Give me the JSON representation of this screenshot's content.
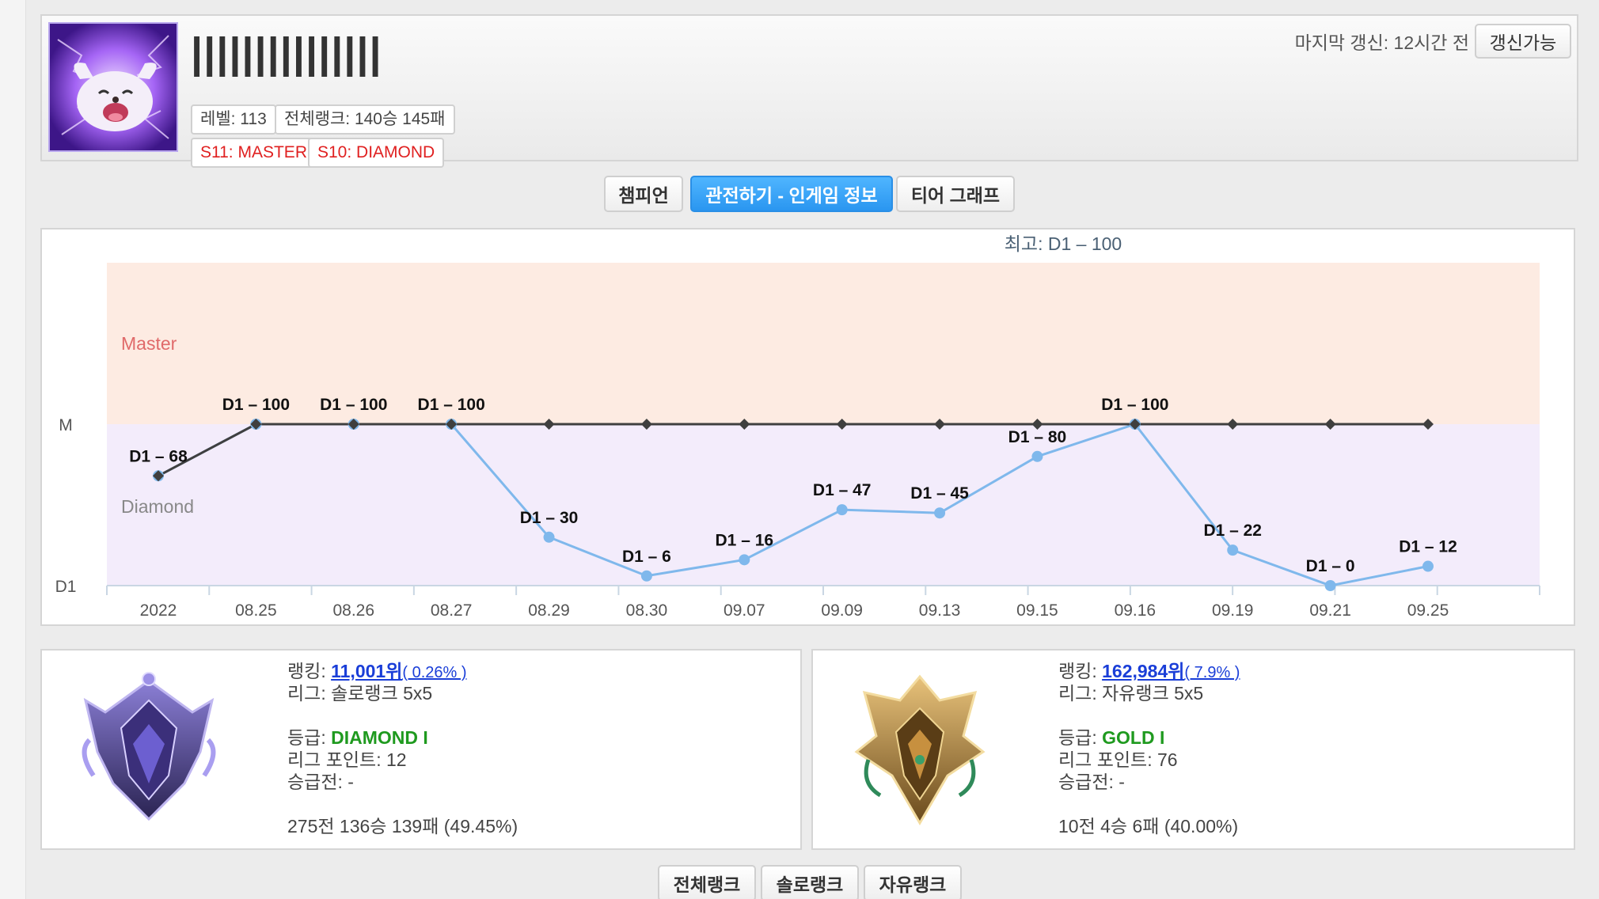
{
  "profile": {
    "name": "|||||||||||||||",
    "level": "레벨: 113",
    "overall_rank": "전체랭크: 140승 145패",
    "season_tags": [
      "S11: MASTER",
      "S10: DIAMOND"
    ],
    "last_update": "마지막 갱신: 12시간 전",
    "refresh_label": "갱신가능"
  },
  "tabs": [
    "챔피언",
    "관전하기 - 인게임 정보",
    "티어 그래프"
  ],
  "active_tab": 1,
  "colors": {
    "accent": "#2a96f0",
    "master_band": "#fdebe2",
    "diamond_band": "#f3ecfb",
    "line_current": "#7fb8ec",
    "line_max": "#3f3f3f",
    "tier_green": "#1f9a1f",
    "link_blue": "#1a3ed8",
    "tag_red": "#e02020"
  },
  "chart_data": {
    "type": "line",
    "title": "최고: D1 – 100",
    "y_tick_labels": [
      "M",
      "D1"
    ],
    "band_labels": [
      "Master",
      "Diamond"
    ],
    "categories": [
      "2022",
      "08.25",
      "08.26",
      "08.27",
      "08.29",
      "08.30",
      "09.07",
      "09.09",
      "09.13",
      "09.15",
      "09.16",
      "09.19",
      "09.21",
      "09.25"
    ],
    "ylim": [
      0,
      200
    ],
    "series": [
      {
        "role": "highest",
        "values": [
          68,
          100,
          100,
          100,
          100,
          100,
          100,
          100,
          100,
          100,
          100,
          100,
          100,
          100
        ]
      },
      {
        "role": "current",
        "values": [
          68,
          100,
          100,
          100,
          30,
          6,
          16,
          47,
          45,
          80,
          100,
          22,
          0,
          12
        ]
      }
    ],
    "data_labels": [
      {
        "index": 0,
        "text": "D1 – 68"
      },
      {
        "index": 1,
        "text": "D1 – 100"
      },
      {
        "index": 2,
        "text": "D1 – 100"
      },
      {
        "index": 3,
        "text": "D1 – 100"
      },
      {
        "index": 4,
        "text": "D1 – 30"
      },
      {
        "index": 5,
        "text": "D1 – 6"
      },
      {
        "index": 6,
        "text": "D1 – 16"
      },
      {
        "index": 7,
        "text": "D1 – 47"
      },
      {
        "index": 8,
        "text": "D1 – 45"
      },
      {
        "index": 9,
        "text": "D1 – 80"
      },
      {
        "index": 10,
        "text": "D1 – 100"
      },
      {
        "index": 11,
        "text": "D1 – 22"
      },
      {
        "index": 12,
        "text": "D1 – 0"
      },
      {
        "index": 13,
        "text": "D1 – 12"
      }
    ]
  },
  "solo": {
    "ranking_label": "랭킹: ",
    "ranking": "11,001위",
    "ranking_pct": "( 0.26% )",
    "league": "리그: 솔로랭크 5x5",
    "tier_label": "등급: ",
    "tier": "DIAMOND I",
    "lp": "리그 포인트: 12",
    "promo": "승급전: -",
    "record": "275전 136승 139패 (49.45%)",
    "emblem": "diamond-emblem"
  },
  "flex": {
    "ranking_label": "랭킹: ",
    "ranking": "162,984위",
    "ranking_pct": "( 7.9% )",
    "league": "리그: 자유랭크 5x5",
    "tier_label": "등급: ",
    "tier": "GOLD I",
    "lp": "리그 포인트: 76",
    "promo": "승급전: -",
    "record": "10전 4승 6패 (40.00%)",
    "emblem": "gold-emblem"
  },
  "bottom_tabs": [
    "전체랭크",
    "솔로랭크",
    "자유랭크"
  ]
}
